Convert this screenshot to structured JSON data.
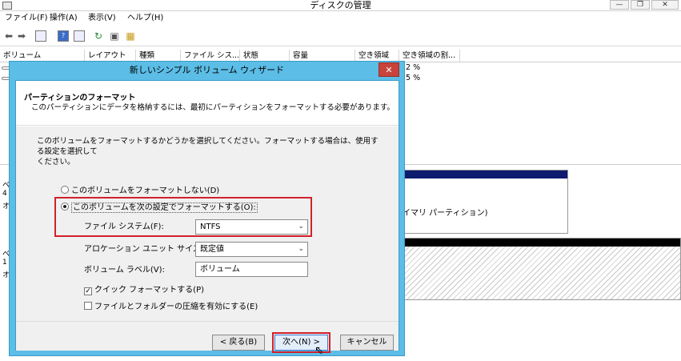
{
  "window": {
    "title": "ディスクの管理",
    "minimize_glyph": "—",
    "maximize_glyph": "❐",
    "close_glyph": "✕"
  },
  "menu": [
    "ファイル(F)",
    "操作(A)",
    "表示(V)",
    "ヘルプ(H)"
  ],
  "toolbar": {
    "icons": [
      "back-arrow-icon",
      "forward-arrow-icon",
      "show-hide-pane-icon",
      "help-icon",
      "properties-icon",
      "refresh-icon",
      "settings-icon",
      "wizard-icon"
    ]
  },
  "columns": [
    "ボリューム",
    "レイアウト",
    "種類",
    "ファイル シス...",
    "状態",
    "容量",
    "空き領域",
    "空き領域の割..."
  ],
  "volume_rows": [
    {
      "free_pct": "2 %"
    },
    {
      "free_pct": "5 %"
    }
  ],
  "background": {
    "partition_label": "イマリ パーティション)",
    "left_labels_1": [
      "ベ",
      "4",
      "オ"
    ],
    "left_labels_2": [
      "ベ",
      "1",
      "オ"
    ]
  },
  "dialog": {
    "title": "新しいシンプル ボリューム ウィザード",
    "close_glyph": "✕",
    "header_title": "パーティションのフォーマット",
    "header_subtitle": "このパーティションにデータを格納するには、最初にパーティションをフォーマットする必要があります。",
    "instruction_line1": "このボリュームをフォーマットするかどうかを選択してください。フォーマットする場合は、使用する設定を選択して",
    "instruction_line2": "ください。",
    "option_no_format": "このボリュームをフォーマットしない(D)",
    "option_format": "このボリュームを次の設定でフォーマットする(O):",
    "file_system_label": "ファイル システム(F):",
    "file_system_value": "NTFS",
    "allocation_label": "アロケーション ユニット サイズ(A):",
    "allocation_value": "既定値",
    "volume_label_label": "ボリューム ラベル(V):",
    "volume_label_value": "ボリューム",
    "quick_format": "クイック フォーマットする(P)",
    "quick_format_checked": true,
    "compression": "ファイルとフォルダーの圧縮を有効にする(E)",
    "compression_checked": false,
    "back_button": "< 戻る(B)",
    "next_button": "次へ(N) >",
    "cancel_button": "キャンセル",
    "highlight_color": "#d3202a",
    "accent_color": "#5cbde6"
  }
}
